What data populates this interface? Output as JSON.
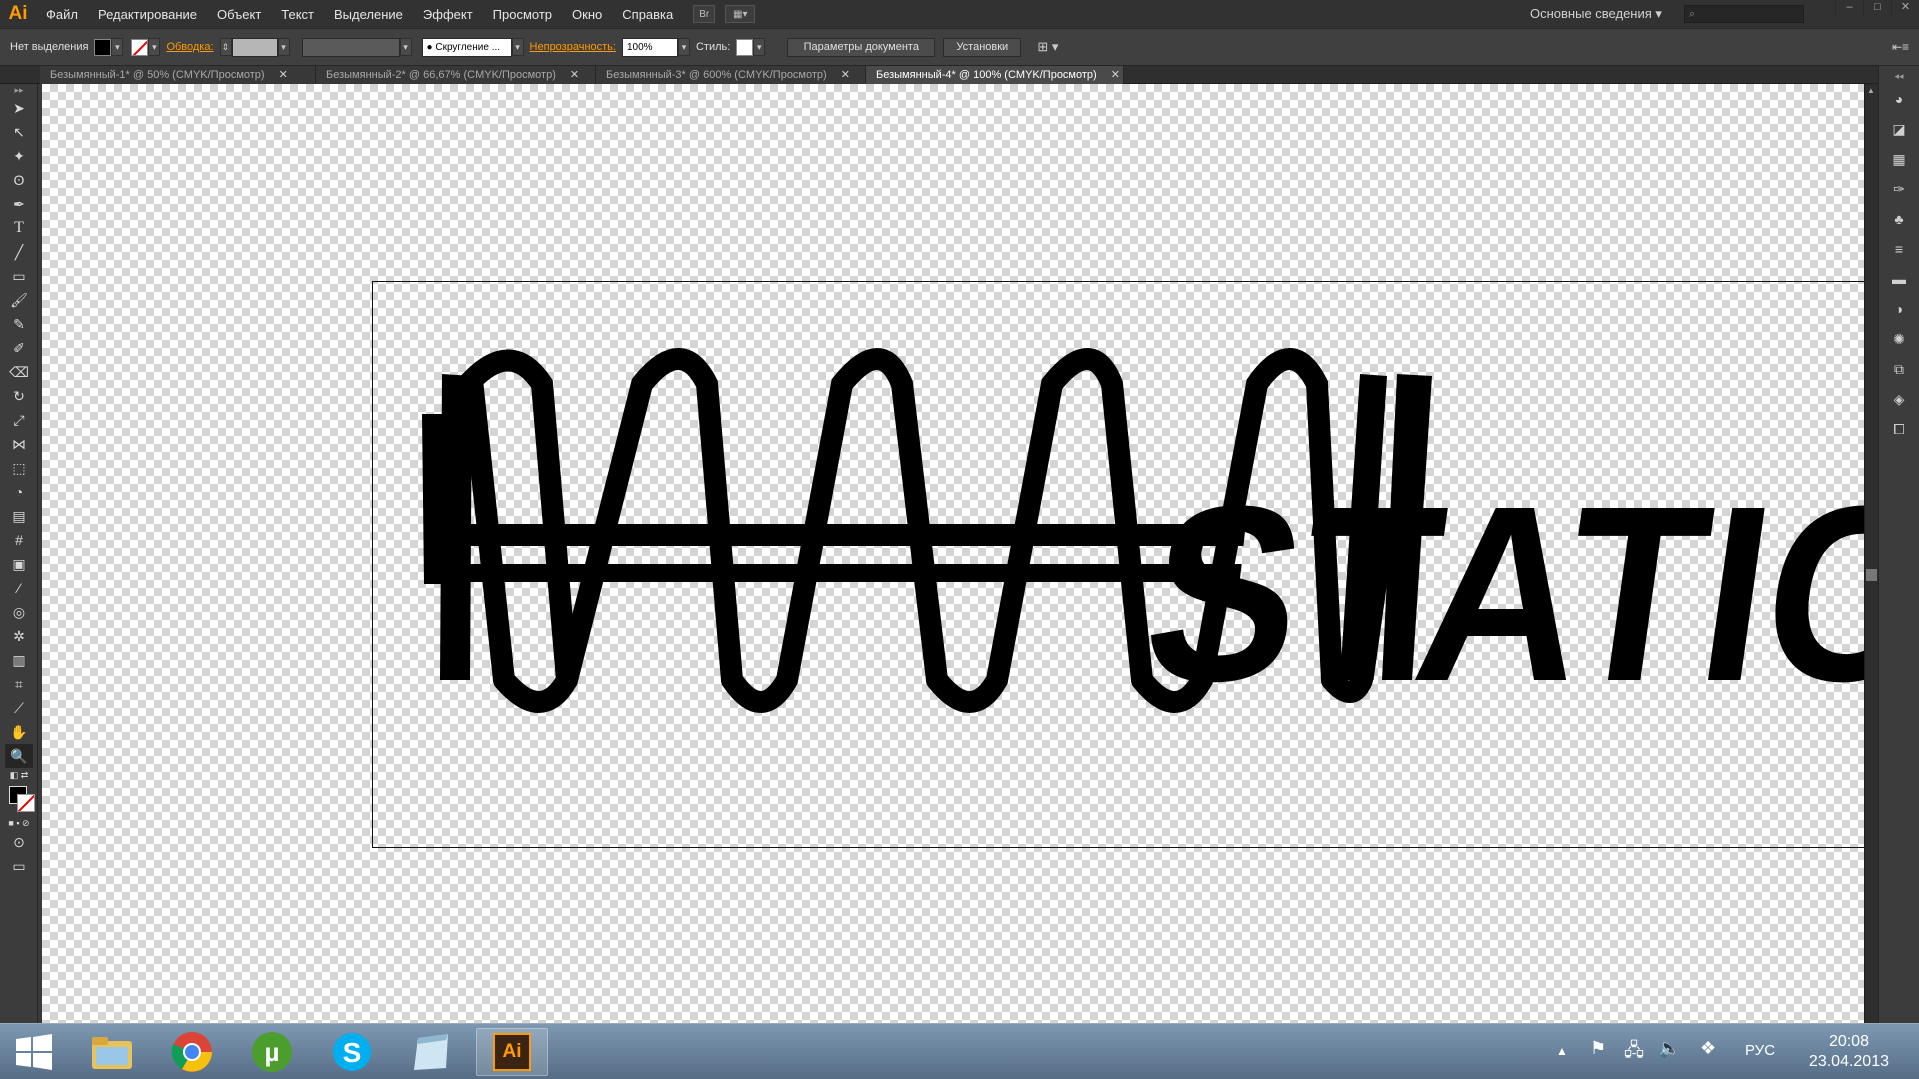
{
  "app": {
    "logo": "Ai"
  },
  "menubar": {
    "items": [
      "Файл",
      "Редактирование",
      "Объект",
      "Текст",
      "Выделение",
      "Эффект",
      "Просмотр",
      "Окно",
      "Справка"
    ],
    "bridge_label": "Br",
    "workspace": "Основные сведения",
    "search_placeholder": "",
    "window_buttons": [
      "–",
      "□",
      "✕"
    ]
  },
  "controlbar": {
    "selection_label": "Нет выделения",
    "stroke_label": "Обводка:",
    "brush_value": "Скругление ...",
    "opacity_label": "Непрозрачность:",
    "opacity_value": "100%",
    "style_label": "Стиль:",
    "doc_params_button": "Параметры документа",
    "settings_button": "Установки"
  },
  "tabs": [
    {
      "label": "Безымянный-1* @ 50% (CMYK/Просмотр)",
      "close": "✕",
      "active": false
    },
    {
      "label": "Безымянный-2* @ 66,67% (CMYK/Просмотр)",
      "close": "✕",
      "active": false
    },
    {
      "label": "Безымянный-3* @ 600% (CMYK/Просмотр)",
      "close": "✕",
      "active": false
    },
    {
      "label": "Безымянный-4* @ 100% (CMYK/Просмотр)",
      "close": "✕",
      "active": true
    }
  ],
  "artwork": {
    "text": "STATIC"
  },
  "taskbar": {
    "ai_label": "Ai",
    "lang": "РУС",
    "time": "20:08",
    "date": "23.04.2013"
  },
  "colors": {
    "accent": "#ff9a00",
    "menubar": "#323232",
    "canvas_check": "#d4d4d4"
  }
}
